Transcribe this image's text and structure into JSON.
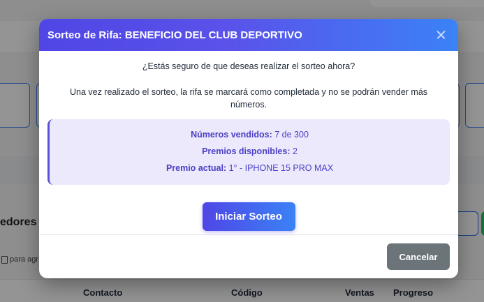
{
  "background": {
    "section_title_fragment": "edores",
    "hint_fragment": "para agr",
    "table_headers": [
      "Contacto",
      "Código",
      "Ventas",
      "Progreso"
    ]
  },
  "modal": {
    "title": "Sorteo de Rifa: BENEFICIO DEL CLUB DEPORTIVO",
    "question": "¿Estás seguro de que deseas realizar el sorteo ahora?",
    "note": "Una vez realizado el sorteo, la rifa se marcará como completada y no se podrán vender más números.",
    "info": {
      "sold_label": "Números vendidos:",
      "sold_value": "7 de 300",
      "prizes_label": "Premios disponibles:",
      "prizes_value": "2",
      "current_label": "Premio actual:",
      "current_value": "1° - IPHONE 15 PRO MAX"
    },
    "start_button": "Iniciar Sorteo",
    "cancel_button": "Cancelar"
  },
  "colors": {
    "header_gradient_start": "#4f46e5",
    "header_gradient_end": "#3b82f6",
    "info_bg": "#ebe9fb",
    "info_text": "#4c3fc7",
    "cancel_bg": "#6b7479"
  }
}
